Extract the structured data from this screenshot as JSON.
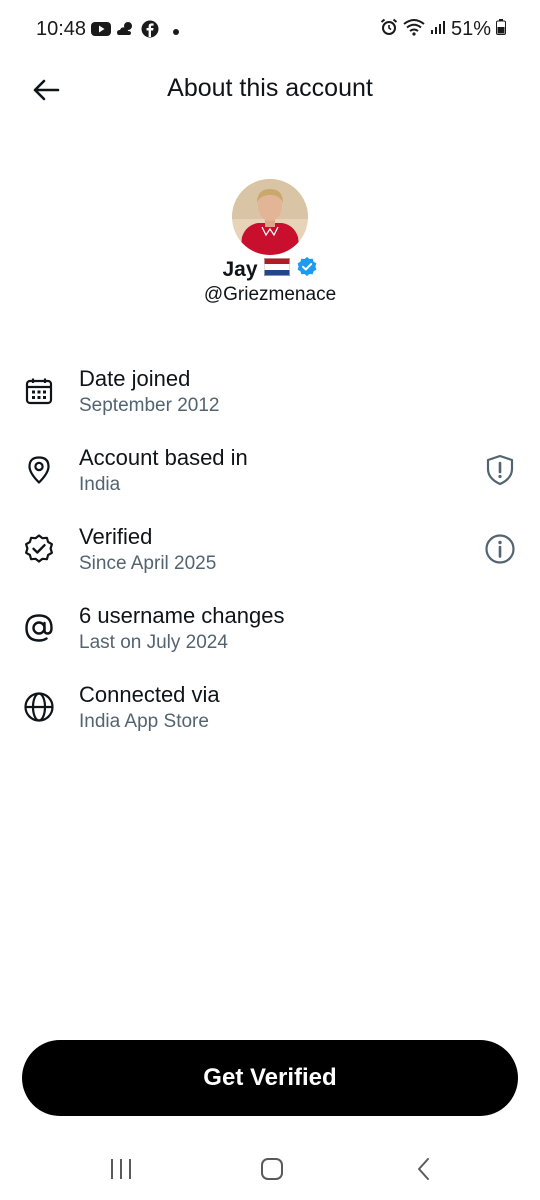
{
  "status_bar": {
    "time": "10:48",
    "battery": "51%"
  },
  "header": {
    "title": "About this account"
  },
  "profile": {
    "name": "Jay",
    "flag": "🇳🇱",
    "handle": "@Griezmenace",
    "verified_color": "#1d9bf0"
  },
  "info": [
    {
      "icon": "calendar-icon",
      "title": "Date joined",
      "subtitle": "September 2012"
    },
    {
      "icon": "location-pin-icon",
      "title": "Account based in",
      "subtitle": "India",
      "trailing_icon": "shield-icon"
    },
    {
      "icon": "verified-badge-icon",
      "title": "Verified",
      "subtitle": "Since April 2025",
      "trailing_icon": "info-icon"
    },
    {
      "icon": "at-sign-icon",
      "title": "6 username changes",
      "subtitle": "Last on July 2024"
    },
    {
      "icon": "globe-icon",
      "title": "Connected via",
      "subtitle": "India App Store"
    }
  ],
  "cta": {
    "label": "Get Verified"
  },
  "nav": {
    "buttons": [
      "recents-icon",
      "home-icon",
      "back-icon"
    ]
  }
}
